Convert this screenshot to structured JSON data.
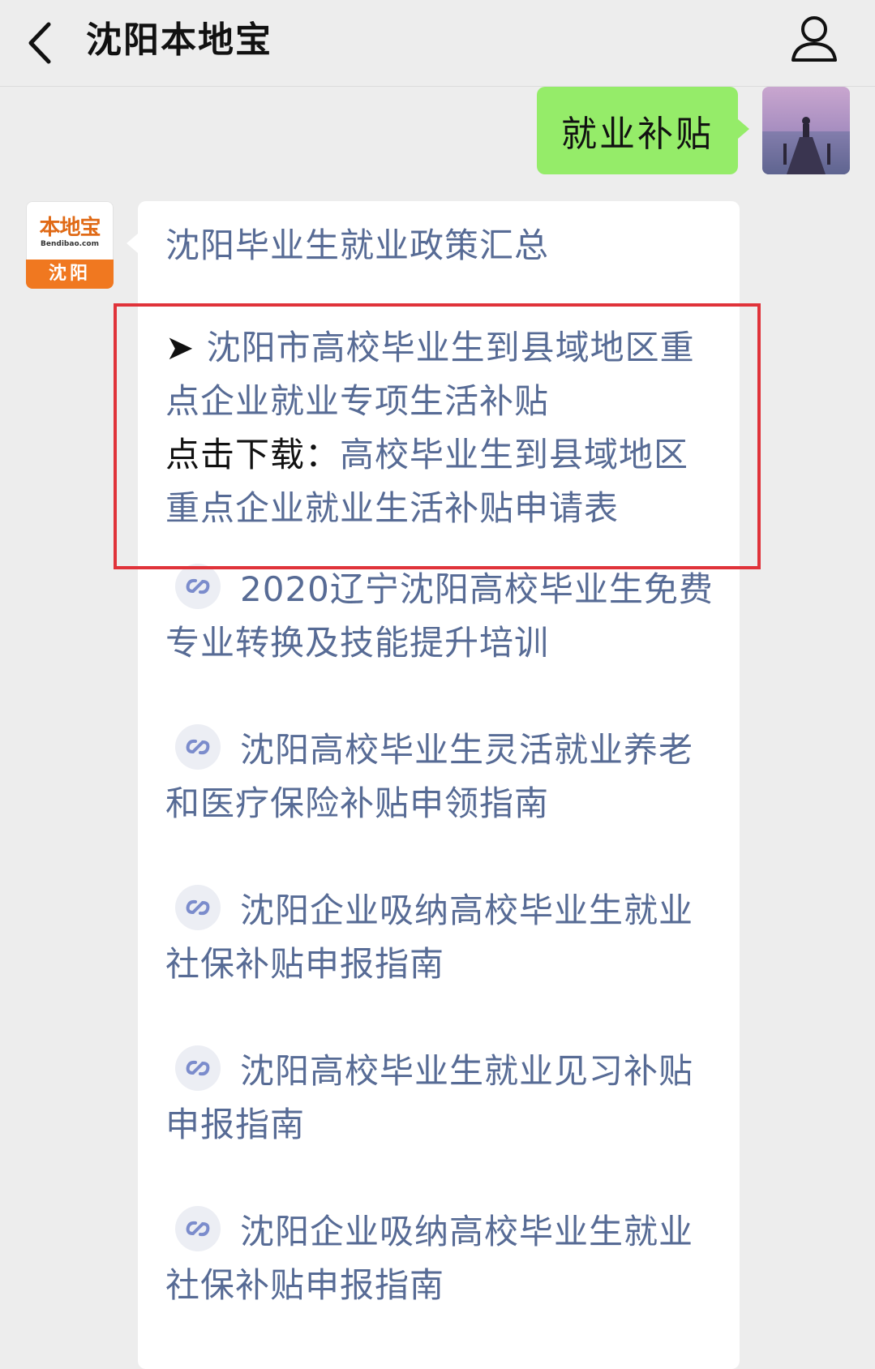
{
  "header": {
    "title": "沈阳本地宝"
  },
  "chat": {
    "user_message": "就业补贴",
    "bot_avatar": {
      "logo_text": "本地宝",
      "logo_url": "Bendibao.com",
      "logo_city": "沈阳"
    },
    "bot_message": {
      "heading": "沈阳毕业生就业政策汇总",
      "highlight": {
        "arrow": "➤",
        "link_title": "沈阳市高校毕业生到县域地区重点企业就业专项生活补贴",
        "download_label": "点击下载：",
        "download_link": "高校毕业生到县域地区重点企业就业生活补贴申请表"
      },
      "links": [
        {
          "label": "2020辽宁沈阳高校毕业生免费专业转换及技能提升培训"
        },
        {
          "label": "沈阳高校毕业生灵活就业养老和医疗保险补贴申领指南"
        },
        {
          "label": "沈阳企业吸纳高校毕业生就业社保补贴申报指南"
        },
        {
          "label": "沈阳高校毕业生就业见习补贴申报指南"
        },
        {
          "label": "沈阳企业吸纳高校毕业生就业社保补贴申报指南"
        }
      ]
    }
  },
  "colors": {
    "link": "#576b95",
    "user_bubble": "#95ec69",
    "highlight_border": "#e0333a"
  },
  "icons": [
    "chevron-left-icon",
    "profile-icon",
    "mini-program-link-icon"
  ]
}
